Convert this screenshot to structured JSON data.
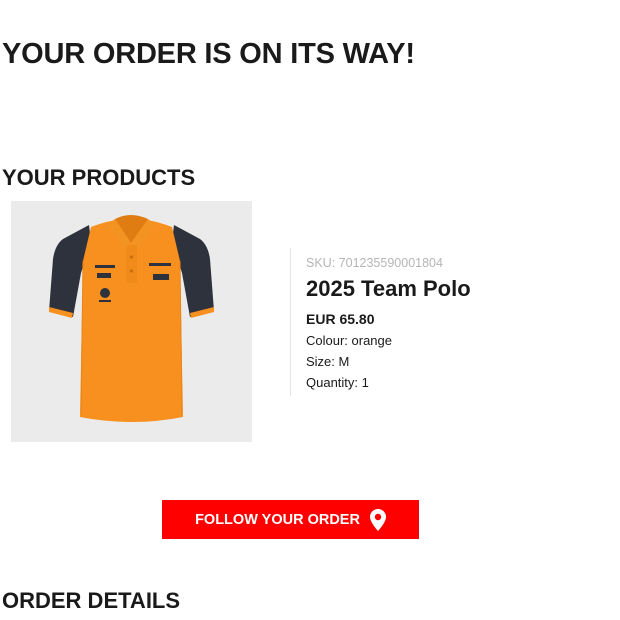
{
  "header": {
    "title": "YOUR ORDER IS ON ITS WAY!"
  },
  "products_section": {
    "title": "YOUR PRODUCTS",
    "items": [
      {
        "sku_label": "SKU:",
        "sku": "701235590001804",
        "name": "2025 Team Polo",
        "price": "EUR 65.80",
        "colour": "Colour: orange",
        "size": "Size: M",
        "quantity": "Quantity: 1",
        "image_icon": "orange-team-polo-shirt"
      }
    ]
  },
  "follow_button": {
    "label": "FOLLOW YOUR ORDER",
    "icon": "location-pin-icon"
  },
  "order_details": {
    "title": "ORDER DETAILS"
  },
  "colors": {
    "accent": "#ff0000",
    "shirt_orange": "#f7901e",
    "shirt_sleeve": "#2e323c",
    "text": "#1a1a1a",
    "muted": "#b5b5b5"
  }
}
